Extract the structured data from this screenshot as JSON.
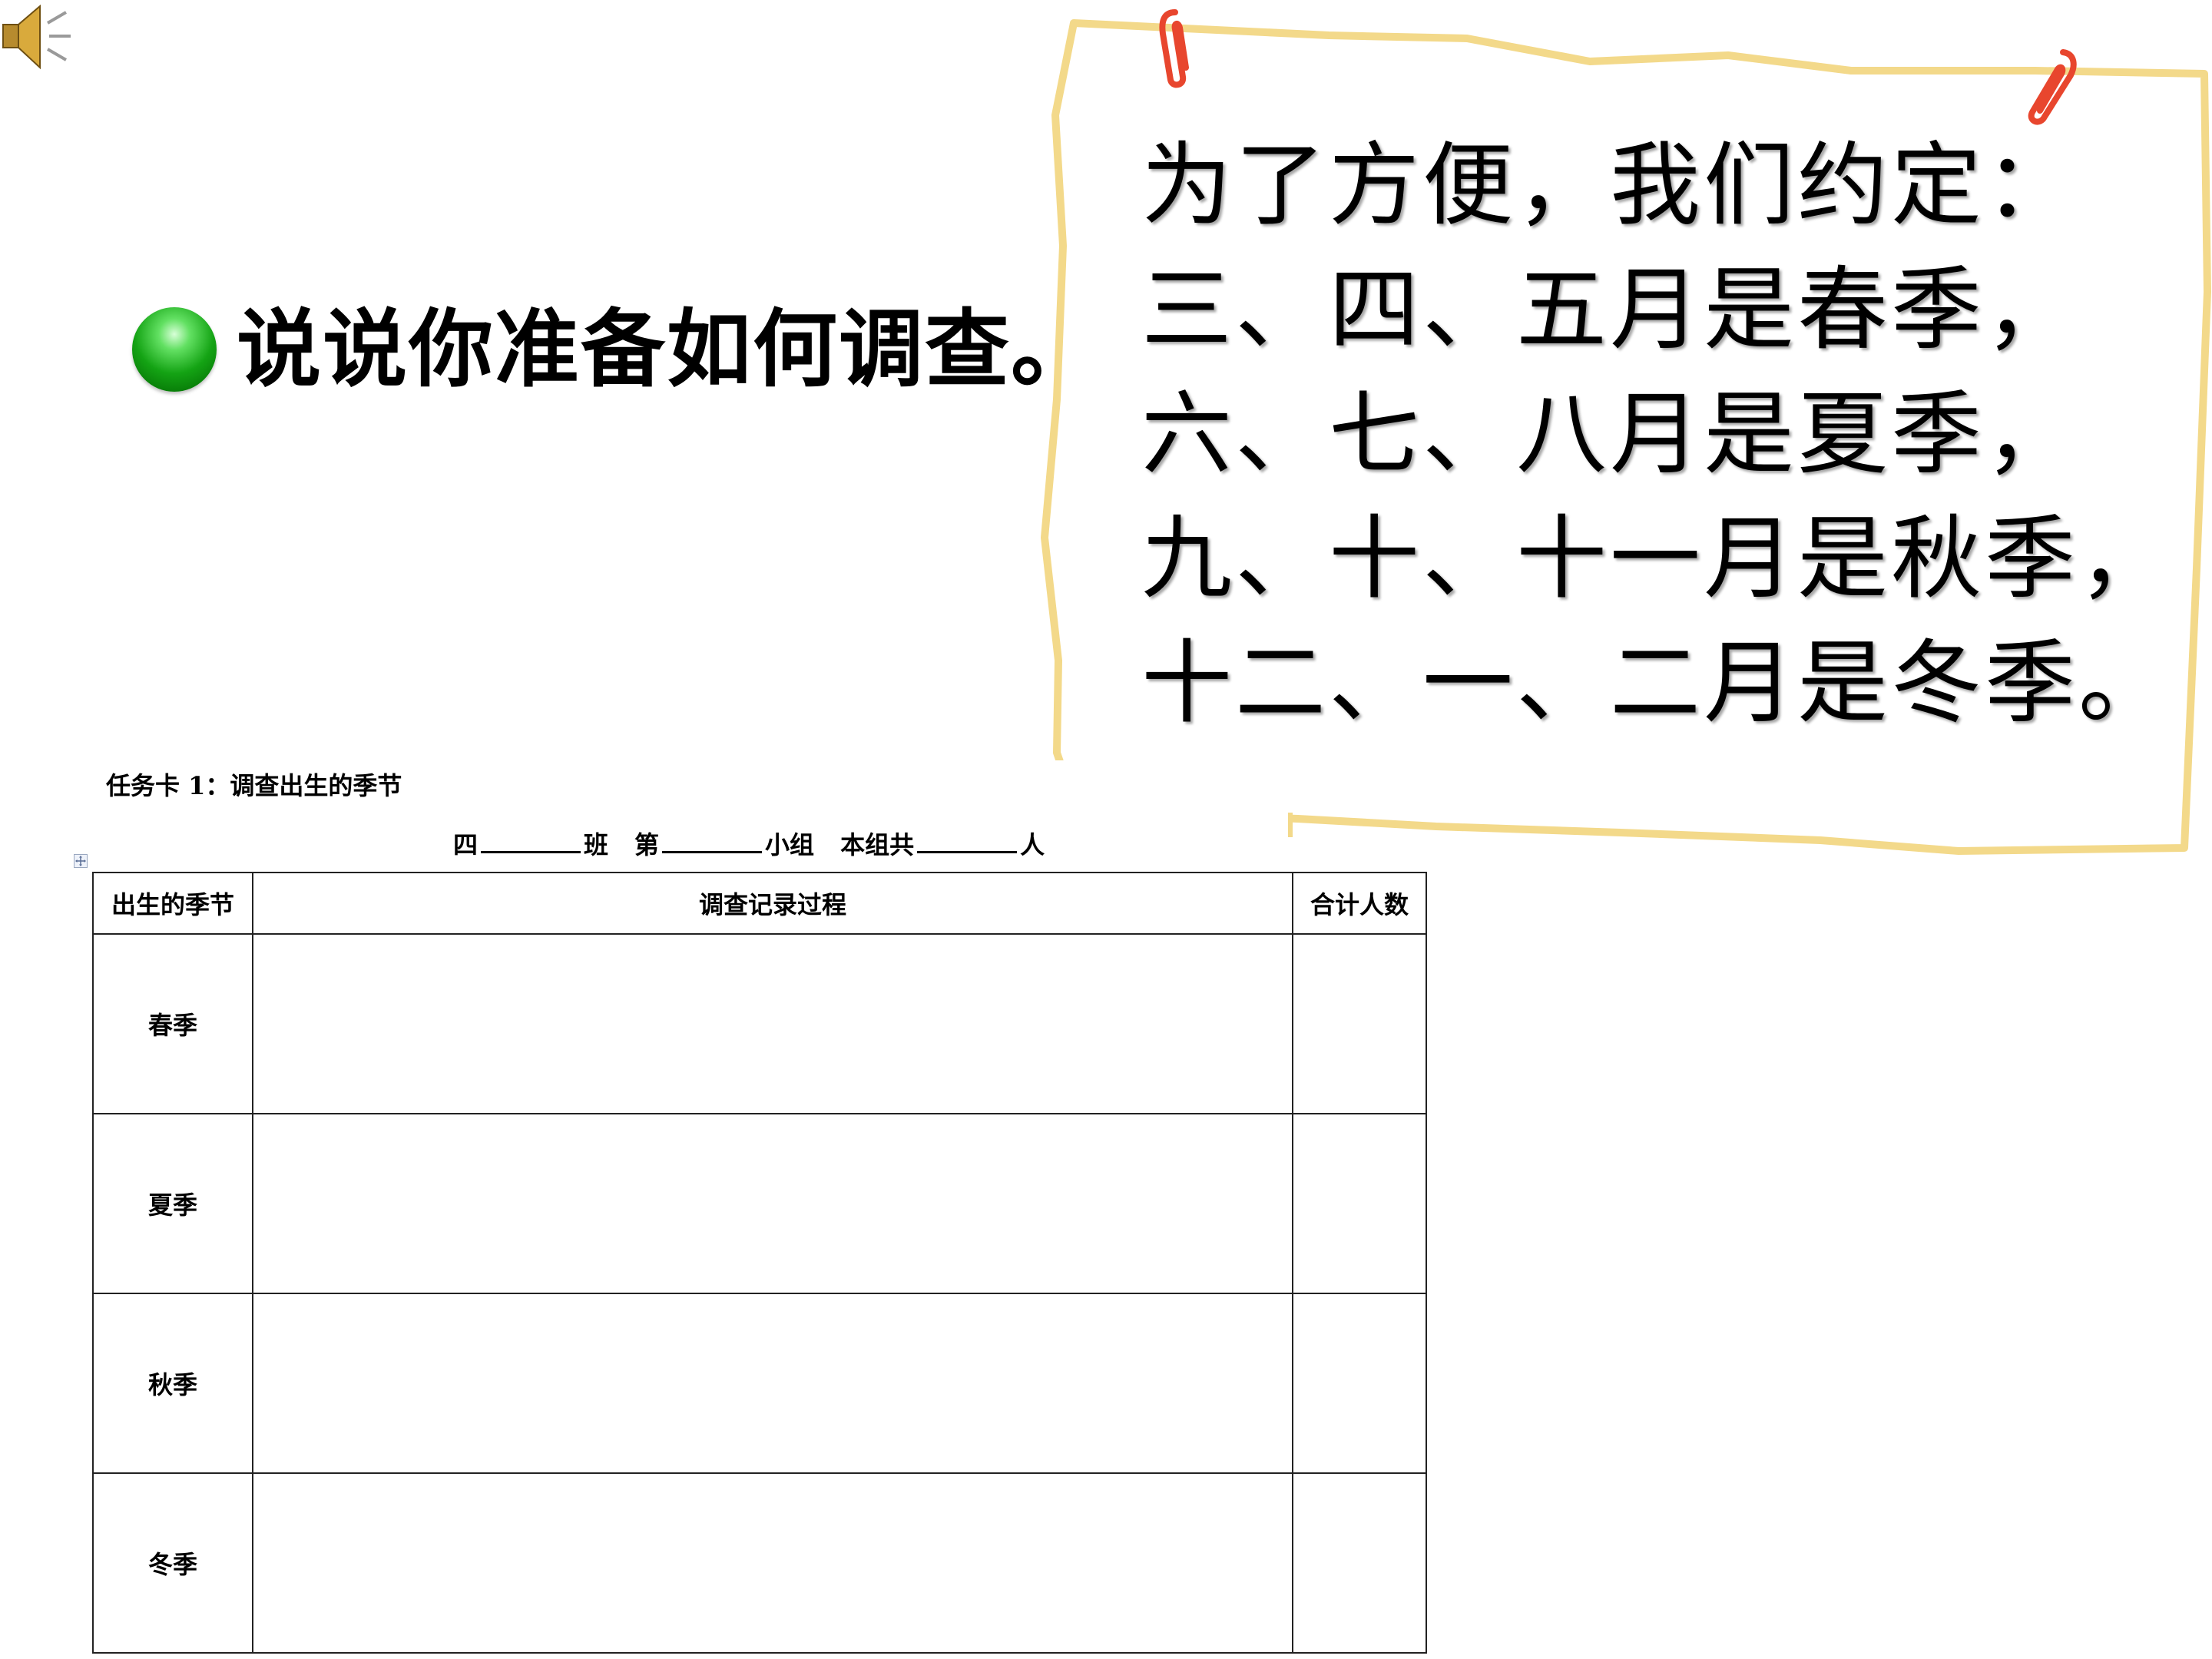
{
  "speaker_icon": "speaker-volume-icon",
  "question": {
    "bullet_icon": "green-sphere-bullet-icon",
    "text": "说说你准备如何调查。"
  },
  "note": {
    "clip_icon": "paperclip-icon",
    "lines": [
      "为了方便，我们约定：",
      "三、四、五月是春季，",
      "六、七、八月是夏季，",
      "九、十、十一月是秋季，",
      "十二、一、二月是冬季。"
    ]
  },
  "task_card": {
    "title": "任务卡 1：调查出生的季节",
    "class_line": {
      "grade": "四",
      "class_label": "班",
      "group_prefix": "第",
      "group_label": "小组",
      "total_prefix": "本组共",
      "total_suffix": "人"
    },
    "table": {
      "headers": [
        "出生的季节",
        "调查记录过程",
        "合计人数"
      ],
      "rows": [
        {
          "season": "春季",
          "record": "",
          "total": ""
        },
        {
          "season": "夏季",
          "record": "",
          "total": ""
        },
        {
          "season": "秋季",
          "record": "",
          "total": ""
        },
        {
          "season": "冬季",
          "record": "",
          "total": ""
        }
      ]
    }
  },
  "colors": {
    "note_border": "#f3d98a",
    "clip": "#e8462e",
    "bullet": "#16a316"
  }
}
